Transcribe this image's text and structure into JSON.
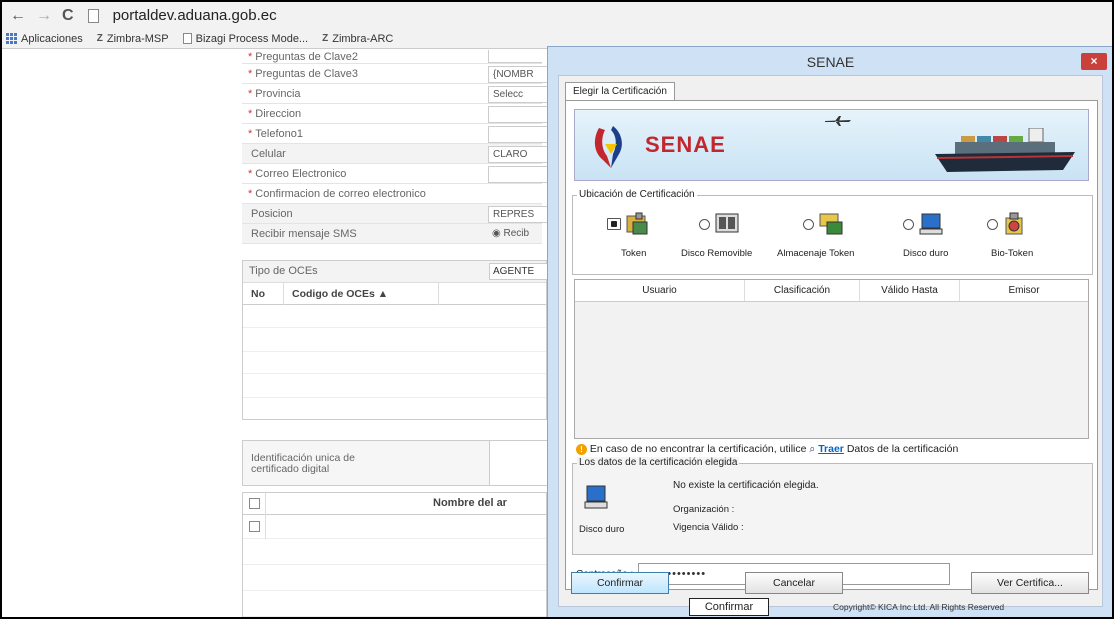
{
  "browser": {
    "back": "←",
    "forward": "→",
    "reload": "C",
    "url": "portaldev.aduana.gob.ec",
    "bookmarks": [
      "Aplicaciones",
      "Zimbra-MSP",
      "Bizagi Process Mode...",
      "Zimbra-ARC"
    ]
  },
  "form": {
    "rows": [
      {
        "label": "Preguntas de Clave2",
        "required": "*",
        "value": ""
      },
      {
        "label": "Preguntas de Clave3",
        "required": "*",
        "value": "{NOMBR"
      },
      {
        "label": "Provincia",
        "required": "*",
        "value": "Selecc"
      },
      {
        "label": "Direccion",
        "required": "*",
        "value": ""
      },
      {
        "label": "Telefono1",
        "required": "*",
        "value": ""
      },
      {
        "label": "Celular",
        "required": "",
        "value": "CLARO"
      },
      {
        "label": "Correo Electronico",
        "required": "*",
        "value": ""
      },
      {
        "label": "Confirmacion de correo electronico",
        "required": "*",
        "value": ""
      },
      {
        "label": "Posicion",
        "required": "",
        "value": "REPRES"
      },
      {
        "label": "Recibir mensaje SMS",
        "required": "",
        "value": "◉ Recib"
      }
    ],
    "ocs_type_label": "Tipo de OCEs",
    "ocs_type_value": "AGENTE",
    "ocs_col_no": "No",
    "ocs_col_code": "Codigo de OCEs ▲",
    "cert_id_label": "Identificación unica de certificado digital",
    "file_col_name": "Nombre del ar"
  },
  "dialog": {
    "title": "SENAE",
    "close": "×",
    "tab": "Elegir la Certificación",
    "brand": "SENAE",
    "location_legend": "Ubicación de Certificación",
    "options": [
      "Token",
      "Disco Removible",
      "Almacenaje Token",
      "Disco duro",
      "Bio-Token"
    ],
    "table_headers": [
      "Usuario",
      "Clasificación",
      "Válido Hasta",
      "Emisor"
    ],
    "tip_prefix": "En caso de no encontrar la certificación, utilice",
    "tip_link": "Traer",
    "tip_suffix": "Datos de la certificación",
    "data_legend": "Los datos de la certificación elegida",
    "device_label": "Disco duro",
    "no_cert": "No existe la certificación elegida.",
    "org_label": "Organización :",
    "validity_label": "Vigencia Válido :",
    "password_label": "Contraseña :",
    "password_value": "•••••••••••••",
    "btn_confirm": "Confirmar",
    "btn_cancel": "Cancelar",
    "btn_view": "Ver Certifica...",
    "bottom_confirm": "Confirmar",
    "copyright": "Copyright© KICA Inc Ltd. All Rights Reserved"
  }
}
